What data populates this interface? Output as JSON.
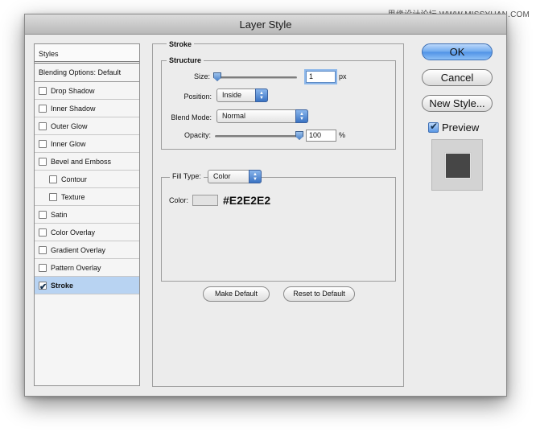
{
  "watermark": "思缘设计论坛 WWW.MISSYUAN.COM",
  "window": {
    "title": "Layer Style"
  },
  "styles_list": {
    "header": "Styles",
    "blending": "Blending Options: Default",
    "items": [
      {
        "label": "Drop Shadow",
        "checked": false
      },
      {
        "label": "Inner Shadow",
        "checked": false
      },
      {
        "label": "Outer Glow",
        "checked": false
      },
      {
        "label": "Inner Glow",
        "checked": false
      },
      {
        "label": "Bevel and Emboss",
        "checked": false
      },
      {
        "label": "Contour",
        "checked": false
      },
      {
        "label": "Texture",
        "checked": false
      },
      {
        "label": "Satin",
        "checked": false
      },
      {
        "label": "Color Overlay",
        "checked": false
      },
      {
        "label": "Gradient Overlay",
        "checked": false
      },
      {
        "label": "Pattern Overlay",
        "checked": false
      },
      {
        "label": "Stroke",
        "checked": true
      }
    ]
  },
  "stroke": {
    "title": "Stroke",
    "structure": {
      "title": "Structure",
      "size_label": "Size:",
      "size_value": "1",
      "size_unit": "px",
      "position_label": "Position:",
      "position_value": "Inside",
      "blend_label": "Blend Mode:",
      "blend_value": "Normal",
      "opacity_label": "Opacity:",
      "opacity_value": "100",
      "opacity_unit": "%"
    },
    "fill": {
      "type_label": "Fill Type:",
      "type_value": "Color",
      "color_label": "Color:",
      "color_hex": "#E2E2E2"
    },
    "make_default": "Make Default",
    "reset_default": "Reset to Default"
  },
  "buttons": {
    "ok": "OK",
    "cancel": "Cancel",
    "new_style": "New Style..."
  },
  "preview": {
    "label": "Preview",
    "checked": true
  }
}
